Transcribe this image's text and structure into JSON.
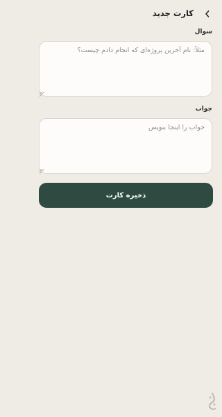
{
  "header": {
    "title": "کارت جدید"
  },
  "question": {
    "label": "سوال",
    "placeholder": "مثلاً: نام آخرین پروژه‌ای که انجام دادم چیست؟",
    "value": ""
  },
  "answer": {
    "label": "جواب",
    "placeholder": "جواب را اینجا بنویس",
    "value": ""
  },
  "actions": {
    "save_label": "ذخیره کارت"
  },
  "colors": {
    "background": "#efebe5",
    "primary": "#2f4a41",
    "field_background": "#fdfcfa",
    "field_border": "#dcd7ce"
  },
  "icons": {
    "back": "chevron-icon",
    "watermark": "app-logo"
  }
}
